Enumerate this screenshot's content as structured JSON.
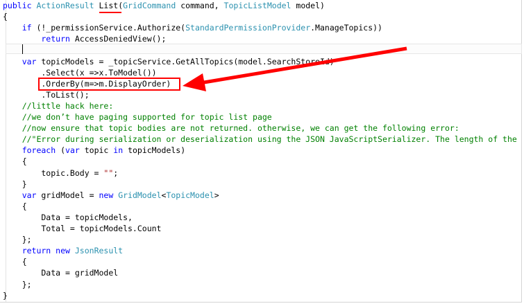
{
  "code_lines": [
    [
      {
        "t": "public ",
        "c": "kw"
      },
      {
        "t": "ActionResult ",
        "c": "ty"
      },
      {
        "t": "List",
        "c": ""
      },
      {
        "t": "(",
        "c": ""
      },
      {
        "t": "GridCommand",
        "c": "ty"
      },
      {
        "t": " command, ",
        "c": ""
      },
      {
        "t": "TopicListModel",
        "c": "ty"
      },
      {
        "t": " model)",
        "c": ""
      }
    ],
    [
      {
        "t": "{",
        "c": ""
      }
    ],
    [
      {
        "t": "    if ",
        "c": "kw"
      },
      {
        "t": "(!_permissionService.Authorize(",
        "c": ""
      },
      {
        "t": "StandardPermissionProvider",
        "c": "ty"
      },
      {
        "t": ".ManageTopics))",
        "c": ""
      }
    ],
    [
      {
        "t": "        return ",
        "c": "kw"
      },
      {
        "t": "AccessDeniedView();",
        "c": ""
      }
    ],
    [
      {
        "t": "",
        "c": ""
      }
    ],
    [
      {
        "t": "    var ",
        "c": "kw"
      },
      {
        "t": "topicModels = _topicService.GetAllTopics(model.SearchStoreId)",
        "c": ""
      }
    ],
    [
      {
        "t": "        .Select(x =>x.ToModel())",
        "c": ""
      }
    ],
    [
      {
        "t": "        .OrderBy(m=>m.DisplayOrder)",
        "c": ""
      }
    ],
    [
      {
        "t": "        .ToList();",
        "c": ""
      }
    ],
    [
      {
        "t": "    //little hack here:",
        "c": "cm"
      }
    ],
    [
      {
        "t": "    //we don’t have paging supported for topic list page",
        "c": "cm"
      }
    ],
    [
      {
        "t": "    //now ensure that topic bodies are not returned. otherwise, we can get the following error:",
        "c": "cm"
      }
    ],
    [
      {
        "t": "    //\"Error during serialization or deserialization using the JSON JavaScriptSerializer. The length of the",
        "c": "cm"
      }
    ],
    [
      {
        "t": "    foreach ",
        "c": "kw"
      },
      {
        "t": "(",
        "c": ""
      },
      {
        "t": "var ",
        "c": "kw"
      },
      {
        "t": "topic ",
        "c": ""
      },
      {
        "t": "in ",
        "c": "kw"
      },
      {
        "t": "topicModels)",
        "c": ""
      }
    ],
    [
      {
        "t": "    {",
        "c": ""
      }
    ],
    [
      {
        "t": "        topic.Body = ",
        "c": ""
      },
      {
        "t": "\"\"",
        "c": "st"
      },
      {
        "t": ";",
        "c": ""
      }
    ],
    [
      {
        "t": "    }",
        "c": ""
      }
    ],
    [
      {
        "t": "    var ",
        "c": "kw"
      },
      {
        "t": "gridModel = ",
        "c": ""
      },
      {
        "t": "new ",
        "c": "kw"
      },
      {
        "t": "GridModel",
        "c": "ty"
      },
      {
        "t": "<",
        "c": ""
      },
      {
        "t": "TopicModel",
        "c": "ty"
      },
      {
        "t": ">",
        "c": ""
      }
    ],
    [
      {
        "t": "    {",
        "c": ""
      }
    ],
    [
      {
        "t": "        Data = topicModels,",
        "c": ""
      }
    ],
    [
      {
        "t": "        Total = topicModels.Count",
        "c": ""
      }
    ],
    [
      {
        "t": "    };",
        "c": ""
      }
    ],
    [
      {
        "t": "    return ",
        "c": "kw"
      },
      {
        "t": "new ",
        "c": "kw"
      },
      {
        "t": "JsonResult",
        "c": "ty"
      }
    ],
    [
      {
        "t": "    {",
        "c": ""
      }
    ],
    [
      {
        "t": "        Data = gridModel",
        "c": ""
      }
    ],
    [
      {
        "t": "    };",
        "c": ""
      }
    ],
    [
      {
        "t": "}",
        "c": ""
      }
    ]
  ],
  "colors": {
    "keyword": "#0000ff",
    "type": "#2b91af",
    "comment": "#008000",
    "string": "#a31515",
    "annotation": "#ff0000"
  }
}
